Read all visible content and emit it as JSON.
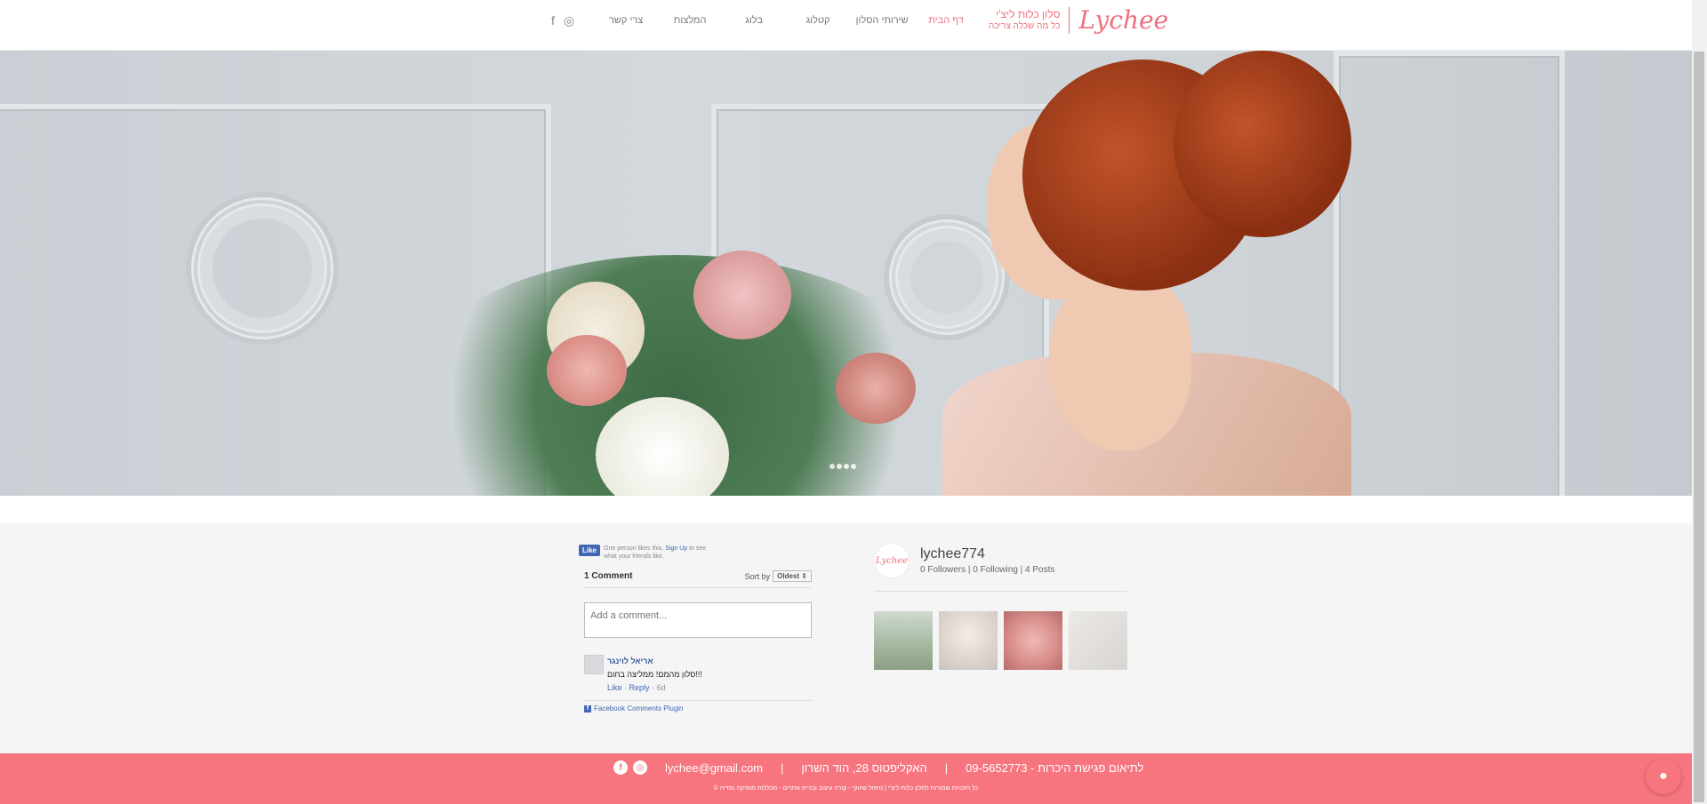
{
  "header": {
    "logo": {
      "mark": "Lychee",
      "subtitle_line1": "סלון כלות ליצ'י",
      "subtitle_line2": "כל מה שכלה צריכה"
    },
    "nav": [
      {
        "label": "דף הבית",
        "active": true
      },
      {
        "label": "שירותי הסלון",
        "active": false
      },
      {
        "label": "קטלוג",
        "active": false
      },
      {
        "label": "בלוג",
        "active": false
      },
      {
        "label": "המלצות",
        "active": false
      },
      {
        "label": "צרי קשר",
        "active": false
      }
    ],
    "social_icons": [
      "instagram-icon",
      "facebook-icon"
    ]
  },
  "hero": {
    "slide_count": 4,
    "active_slide": 1
  },
  "fb_like": {
    "button_label": "Like",
    "text_before": "One person likes this.",
    "link": "Sign Up",
    "text_after": "to see what your friends like."
  },
  "comments": {
    "count_label": "1 Comment",
    "sort_label": "Sort by",
    "sort_value": "Oldest",
    "input_placeholder": "Add a comment...",
    "items": [
      {
        "author": "אריאל לוינגר",
        "text": "סלון מהמם! ממליצה בחום!!!",
        "like": "Like",
        "reply": "Reply",
        "age": "6d"
      }
    ],
    "plugin_label": "Facebook Comments Plugin"
  },
  "profile": {
    "avatar_text": "Lychee",
    "name": "lychee774",
    "followers": "0 Followers",
    "following": "0 Following",
    "posts": "4 Posts",
    "thumbnails": [
      "photo-couple",
      "photo-bride",
      "photo-hairstyle",
      "photo-accessories"
    ]
  },
  "footer": {
    "phone_text": "לתיאום פגישת היכרות - 09-5652773",
    "address": "האקליפטוס 28, הוד השרון",
    "email": "lychee@gmail.com",
    "separator": "|",
    "copyright": "© כל הזכויות שמורות לסלון כלות ליצ'י | טיפול שיווקי - קורה עיצוב ובניית אתרים - מכללות מוסיקה ומדיה"
  },
  "colors": {
    "brand": "#f06e7d",
    "footer_bg": "#f7757e",
    "fb_blue": "#4267b2"
  }
}
